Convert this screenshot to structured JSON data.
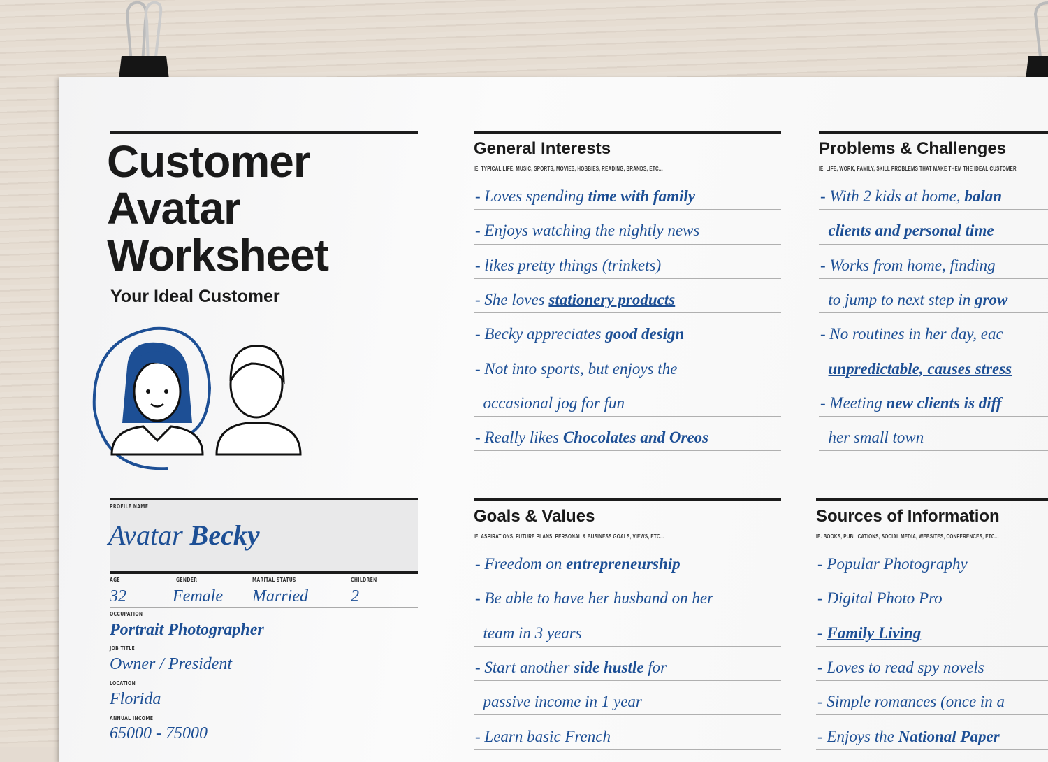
{
  "title": [
    "Customer",
    "Avatar",
    "Worksheet"
  ],
  "subtitle": "Your Ideal Customer",
  "accent": "#1d4f95",
  "profile": {
    "name_label": "PROFILE NAME",
    "name_first": "Avatar",
    "name_bold": "Becky",
    "age_label": "AGE",
    "age": "32",
    "gender_label": "GENDER",
    "gender": "Female",
    "marital_label": "MARITAL STATUS",
    "marital": "Married",
    "children_label": "CHILDREN",
    "children": "2",
    "occupation_label": "OCCUPATION",
    "occupation": "Portrait Photographer",
    "job_label": "JOB TITLE",
    "job": "Owner / President",
    "location_label": "LOCATION",
    "location": "Florida",
    "income_label": "ANNUAL INCOME",
    "income": "65000 - 75000"
  },
  "sections": [
    {
      "title": "General Interests",
      "hint": "IE. TYPICAL LIFE, MUSIC, SPORTS, MOVIES, HOBBIES, READING, BRANDS, ETC...",
      "rows": [
        [
          {
            "t": "- Loves spending "
          },
          {
            "t": "time with family",
            "b": true
          }
        ],
        [
          {
            "t": "- Enjoys watching the nightly news"
          }
        ],
        [
          {
            "t": "- likes pretty things (trinkets)"
          }
        ],
        [
          {
            "t": "- She loves "
          },
          {
            "t": "stationery products",
            "b": true,
            "u": true
          }
        ],
        [
          {
            "t": "- Becky appreciates "
          },
          {
            "t": "good design",
            "b": true
          }
        ],
        [
          {
            "t": "- Not into sports, but enjoys the"
          }
        ],
        [
          {
            "t": "  occasional jog for fun"
          }
        ],
        [
          {
            "t": "- Really likes "
          },
          {
            "t": "Chocolates and Oreos",
            "b": true
          }
        ]
      ]
    },
    {
      "title": "Problems & Challenges",
      "hint": "IE. LIFE, WORK, FAMILY, SKILL PROBLEMS THAT MAKE THEM THE IDEAL CUSTOMER",
      "rows": [
        [
          {
            "t": "- With 2 kids at home, "
          },
          {
            "t": "balan",
            "b": true
          }
        ],
        [
          {
            "t": "  "
          },
          {
            "t": "clients and personal time",
            "b": true
          }
        ],
        [
          {
            "t": "- Works from home, finding"
          }
        ],
        [
          {
            "t": "  to jump to next step in "
          },
          {
            "t": "grow",
            "b": true
          }
        ],
        [
          {
            "t": "- No routines in her day, eac"
          }
        ],
        [
          {
            "t": "  "
          },
          {
            "t": "unpredictable, causes stress",
            "b": true,
            "u": true
          }
        ],
        [
          {
            "t": "- Meeting "
          },
          {
            "t": "new clients is diff",
            "b": true
          }
        ],
        [
          {
            "t": "  her small town"
          }
        ]
      ]
    },
    {
      "title": "Goals & Values",
      "hint": "IE. ASPIRATIONS, FUTURE PLANS, PERSONAL & BUSINESS GOALS, VIEWS, ETC...",
      "rows": [
        [
          {
            "t": "- Freedom on "
          },
          {
            "t": "entrepreneurship",
            "b": true
          }
        ],
        [
          {
            "t": "- Be able to have her husband on her"
          }
        ],
        [
          {
            "t": "  team in 3 years"
          }
        ],
        [
          {
            "t": "- Start another "
          },
          {
            "t": "side hustle",
            "b": true
          },
          {
            "t": " for"
          }
        ],
        [
          {
            "t": "  passive income in 1 year"
          }
        ],
        [
          {
            "t": "- Learn basic French"
          }
        ]
      ]
    },
    {
      "title": "Sources of Information",
      "hint": "IE. BOOKS, PUBLICATIONS, SOCIAL MEDIA, WEBSITES, CONFERENCES, ETC...",
      "rows": [
        [
          {
            "t": "- Popular Photography"
          }
        ],
        [
          {
            "t": "- Digital Photo Pro"
          }
        ],
        [
          {
            "t": "- ",
            "b": true
          },
          {
            "t": "Family Living",
            "b": true,
            "u": true
          }
        ],
        [
          {
            "t": "- Loves to read spy novels"
          }
        ],
        [
          {
            "t": "- Simple romances (once in a"
          }
        ],
        [
          {
            "t": "- Enjoys the "
          },
          {
            "t": "National Paper",
            "b": true
          }
        ]
      ]
    }
  ]
}
